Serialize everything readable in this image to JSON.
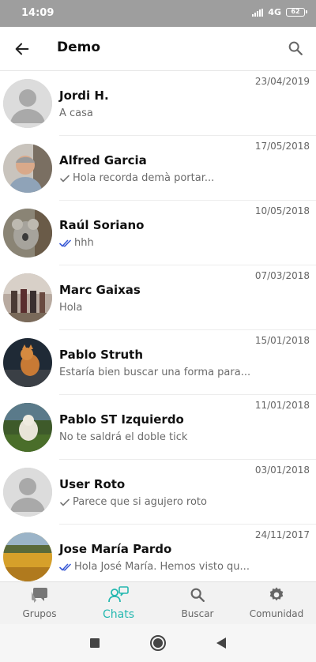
{
  "status_bar": {
    "time": "14:09",
    "network": "4G",
    "battery": "62"
  },
  "app_bar": {
    "title": "Demo"
  },
  "chats": [
    {
      "name": "Jordi H.",
      "date": "23/04/2019",
      "preview": "A casa",
      "tick": "none",
      "avatar": "placeholder"
    },
    {
      "name": "Alfred Garcia",
      "date": "17/05/2018",
      "preview": "Hola recorda demà portar...",
      "tick": "single",
      "avatar": "photo"
    },
    {
      "name": "Raúl Soriano",
      "date": "10/05/2018",
      "preview": "hhh",
      "tick": "double-read",
      "avatar": "photo"
    },
    {
      "name": "Marc Gaixas",
      "date": "07/03/2018",
      "preview": "Hola",
      "tick": "none",
      "avatar": "photo"
    },
    {
      "name": "Pablo Struth",
      "date": "15/01/2018",
      "preview": "Estaría bien buscar una forma para...",
      "tick": "none",
      "avatar": "photo"
    },
    {
      "name": "Pablo ST Izquierdo",
      "date": "11/01/2018",
      "preview": "No te saldrá el doble tick",
      "tick": "none",
      "avatar": "photo"
    },
    {
      "name": "User Roto",
      "date": "03/01/2018",
      "preview": "Parece que si agujero roto",
      "tick": "single",
      "avatar": "placeholder"
    },
    {
      "name": "Jose María Pardo",
      "date": "24/11/2017",
      "preview": "Hola José María.  Hemos visto qu...",
      "tick": "double-read",
      "avatar": "photo"
    }
  ],
  "bottom_nav": [
    {
      "label": "Grupos",
      "icon": "groups-icon",
      "active": false
    },
    {
      "label": "Chats",
      "icon": "chats-icon",
      "active": true
    },
    {
      "label": "Buscar",
      "icon": "search-icon",
      "active": false
    },
    {
      "label": "Comunidad",
      "icon": "gear-icon",
      "active": false
    }
  ],
  "colors": {
    "accent": "#25b8b0",
    "read_tick": "#3b5bd6",
    "status_bar": "#9e9e9e"
  }
}
